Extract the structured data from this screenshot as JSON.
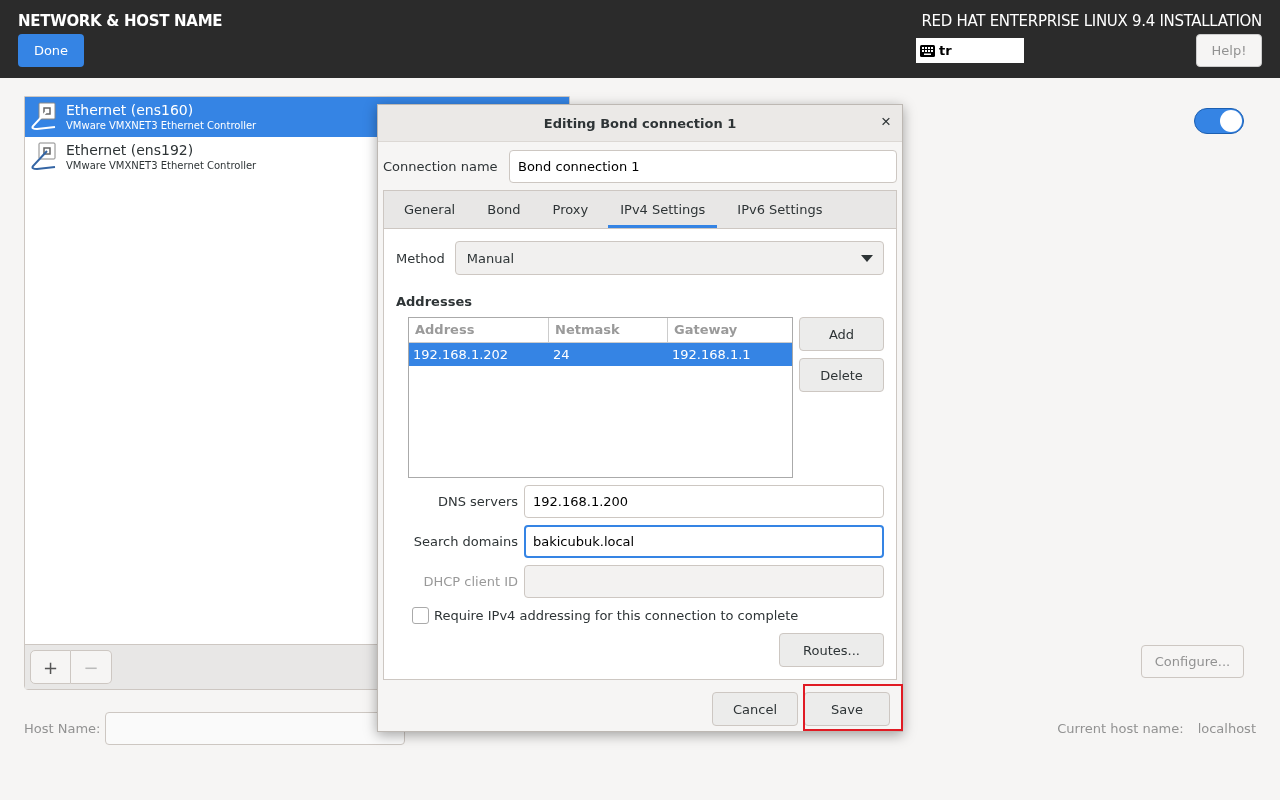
{
  "header": {
    "title": "NETWORK & HOST NAME",
    "done_button": "Done",
    "product_title": "RED HAT ENTERPRISE LINUX 9.4 INSTALLATION",
    "keyboard_layout": "tr",
    "help_button": "Help!"
  },
  "devices": [
    {
      "name": "Ethernet (ens160)",
      "description": "VMware VMXNET3 Ethernet Controller",
      "selected": true
    },
    {
      "name": "Ethernet (ens192)",
      "description": "VMware VMXNET3 Ethernet Controller",
      "selected": false
    }
  ],
  "device_toolbar": {
    "add": {
      "label": "+",
      "disabled": false
    },
    "remove": {
      "label": "−",
      "disabled": true
    }
  },
  "connection_switch": {
    "on": true
  },
  "configure_button": "Configure...",
  "host_name": {
    "label": "Host Name:"
  },
  "current_host": {
    "label": "Current host name:",
    "value": "localhost"
  },
  "dialog": {
    "title": "Editing Bond connection 1",
    "close": "×",
    "connection_name": {
      "label": "Connection name",
      "value": "Bond connection 1"
    },
    "tabs": [
      {
        "label": "General",
        "selected": false
      },
      {
        "label": "Bond",
        "selected": false
      },
      {
        "label": "Proxy",
        "selected": false
      },
      {
        "label": "IPv4 Settings",
        "selected": true
      },
      {
        "label": "IPv6 Settings",
        "selected": false
      }
    ],
    "method": {
      "label": "Method",
      "value": "Manual"
    },
    "addresses": {
      "heading": "Addresses",
      "columns": [
        "Address",
        "Netmask",
        "Gateway"
      ],
      "rows": [
        {
          "cells": [
            "192.168.1.202",
            "24",
            "192.168.1.1"
          ],
          "selected": true
        }
      ],
      "add_button": "Add",
      "delete_button": "Delete"
    },
    "fields": [
      {
        "label": "DNS servers",
        "value": "192.168.1.200",
        "focused": false,
        "disabled": false
      },
      {
        "label": "Search domains",
        "value": "bakicubuk.local",
        "focused": true,
        "disabled": false
      },
      {
        "label": "DHCP client ID",
        "focused": false,
        "disabled": true
      }
    ],
    "require_checkbox": {
      "label": "Require IPv4 addressing for this connection to complete",
      "checked": false
    },
    "routes_button": "Routes...",
    "cancel_button": "Cancel",
    "save_button": {
      "label": "Save",
      "highlighted": true
    }
  }
}
